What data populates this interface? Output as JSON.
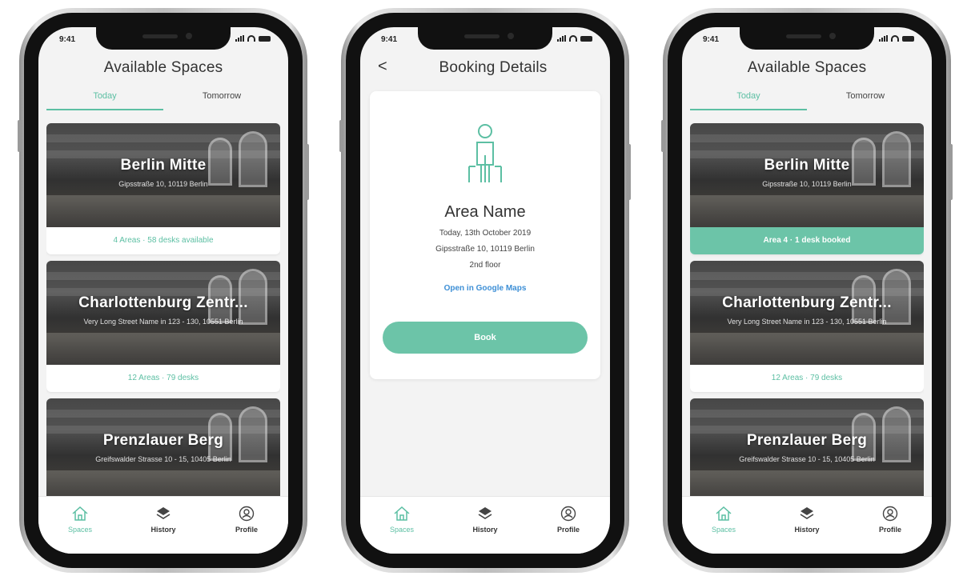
{
  "accent_color": "#5cbfa3",
  "phones": {
    "left": {
      "status_time": "9:41",
      "title": "Available Spaces",
      "tabs": [
        "Today",
        "Tomorrow"
      ],
      "cards": [
        {
          "name": "Berlin Mitte",
          "address": "Gipsstraße 10, 10119 Berlin",
          "footer": "4 Areas · 58 desks available"
        },
        {
          "name": "Charlottenburg Zentr...",
          "address": "Very Long Street Name in 123 - 130, 10551 Berlin",
          "footer": "12 Areas · 79 desks"
        },
        {
          "name": "Prenzlauer Berg",
          "address": "Greifswalder Strasse 10 - 15, 10405 Berlin",
          "footer": ""
        }
      ],
      "tabbar": [
        {
          "label": "Spaces",
          "icon": "home-icon"
        },
        {
          "label": "History",
          "icon": "history-icon"
        },
        {
          "label": "Profile",
          "icon": "profile-icon"
        }
      ]
    },
    "middle": {
      "status_time": "9:41",
      "back_symbol": "<",
      "title": "Booking Details",
      "area_name": "Area Name",
      "date_line": "Today, 13th October 2019",
      "address_line": "Gipsstraße 10, 10119 Berlin",
      "floor_line": "2nd floor",
      "maps_link": "Open in Google Maps",
      "book_label": "Book",
      "tabbar": [
        {
          "label": "Spaces",
          "icon": "home-icon"
        },
        {
          "label": "History",
          "icon": "history-icon"
        },
        {
          "label": "Profile",
          "icon": "profile-icon"
        }
      ]
    },
    "right": {
      "status_time": "9:41",
      "title": "Available Spaces",
      "tabs": [
        "Today",
        "Tomorrow"
      ],
      "cards": [
        {
          "name": "Berlin Mitte",
          "address": "Gipsstraße 10, 10119 Berlin",
          "footer": "Area 4 · 1 desk booked"
        },
        {
          "name": "Charlottenburg Zentr...",
          "address": "Very Long Street Name in 123 - 130, 10551 Berlin",
          "footer": "12 Areas · 79 desks"
        },
        {
          "name": "Prenzlauer Berg",
          "address": "Greifswalder Strasse 10 - 15, 10405 Berlin",
          "footer": ""
        }
      ],
      "tabbar": [
        {
          "label": "Spaces",
          "icon": "home-icon"
        },
        {
          "label": "History",
          "icon": "history-icon"
        },
        {
          "label": "Profile",
          "icon": "profile-icon"
        }
      ]
    }
  }
}
